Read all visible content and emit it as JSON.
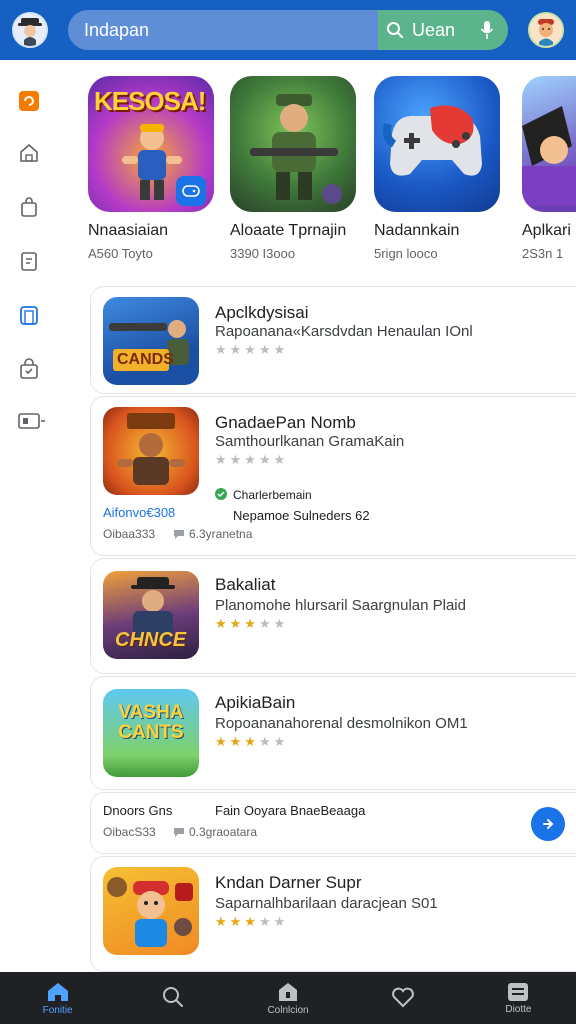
{
  "search": {
    "query": "Indapan",
    "button_label": "Uean"
  },
  "featured": [
    {
      "title": "Nnaasiaian",
      "subtitle": "A560 Toyto",
      "banner": "KESOSA!"
    },
    {
      "title": "Aloaate Tprnajin",
      "subtitle": "3390 I3ooo"
    },
    {
      "title": "Nadannkain",
      "subtitle": "5rign looco"
    },
    {
      "title": "Aplkari",
      "subtitle": "2S3n 1"
    }
  ],
  "list": [
    {
      "title": "Apclkdysisai",
      "desc": "Rapoanana«Karsdvdan Henaulan IOnl",
      "icon_text": "CANDS"
    },
    {
      "title": "GnadaePan Nomb",
      "desc": "Samthourlkanan GramaKain",
      "badge": "Charlerbemain",
      "meta1": "Nepamoe Sulneders 62",
      "link": "Aifonvo€308",
      "stat1": "Oibaa333",
      "stat2": "6.3yranetna"
    },
    {
      "title": "Bakaliat",
      "desc": "Planomohe hlursaril Saargnulan Plaid",
      "icon_text": "CHNCE"
    },
    {
      "title": "ApikiaBain",
      "desc": "Ropoananahorenal desmolnikon OM1",
      "icon_text": "VASHA CANTS"
    },
    {
      "row_left": "Dnoors Gns",
      "row_right": "Fain Ooyara BnaeBeaaga",
      "stat1": "OibacS33",
      "stat2": "0.3graoatara"
    },
    {
      "title": "Kndan Darner Supr",
      "desc": "Saparnalhbarilaan daracjean S01"
    }
  ],
  "bottom_nav": [
    {
      "label": "Fonitie",
      "icon": "home-icon",
      "active": true
    },
    {
      "label": "",
      "icon": "search-icon",
      "active": false
    },
    {
      "label": "Colnlcion",
      "icon": "store-icon",
      "active": false
    },
    {
      "label": "",
      "icon": "heart-icon",
      "active": false
    },
    {
      "label": "Diotte",
      "icon": "list-icon",
      "active": false
    }
  ],
  "colors": {
    "header": "#1560c2",
    "accent": "#1a73e8",
    "star": "#e5a711"
  }
}
